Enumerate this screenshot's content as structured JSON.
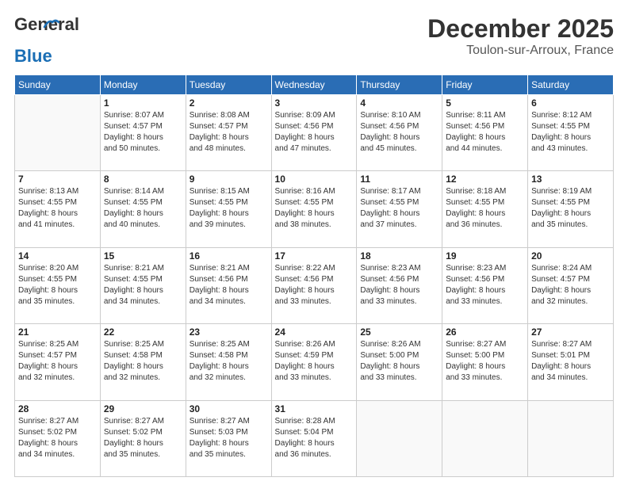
{
  "header": {
    "logo_general": "General",
    "logo_blue": "Blue",
    "month_title": "December 2025",
    "location": "Toulon-sur-Arroux, France"
  },
  "days_of_week": [
    "Sunday",
    "Monday",
    "Tuesday",
    "Wednesday",
    "Thursday",
    "Friday",
    "Saturday"
  ],
  "weeks": [
    [
      {
        "day": null,
        "info": null
      },
      {
        "day": "1",
        "info": "Sunrise: 8:07 AM\nSunset: 4:57 PM\nDaylight: 8 hours\nand 50 minutes."
      },
      {
        "day": "2",
        "info": "Sunrise: 8:08 AM\nSunset: 4:57 PM\nDaylight: 8 hours\nand 48 minutes."
      },
      {
        "day": "3",
        "info": "Sunrise: 8:09 AM\nSunset: 4:56 PM\nDaylight: 8 hours\nand 47 minutes."
      },
      {
        "day": "4",
        "info": "Sunrise: 8:10 AM\nSunset: 4:56 PM\nDaylight: 8 hours\nand 45 minutes."
      },
      {
        "day": "5",
        "info": "Sunrise: 8:11 AM\nSunset: 4:56 PM\nDaylight: 8 hours\nand 44 minutes."
      },
      {
        "day": "6",
        "info": "Sunrise: 8:12 AM\nSunset: 4:55 PM\nDaylight: 8 hours\nand 43 minutes."
      }
    ],
    [
      {
        "day": "7",
        "info": "Sunrise: 8:13 AM\nSunset: 4:55 PM\nDaylight: 8 hours\nand 41 minutes."
      },
      {
        "day": "8",
        "info": "Sunrise: 8:14 AM\nSunset: 4:55 PM\nDaylight: 8 hours\nand 40 minutes."
      },
      {
        "day": "9",
        "info": "Sunrise: 8:15 AM\nSunset: 4:55 PM\nDaylight: 8 hours\nand 39 minutes."
      },
      {
        "day": "10",
        "info": "Sunrise: 8:16 AM\nSunset: 4:55 PM\nDaylight: 8 hours\nand 38 minutes."
      },
      {
        "day": "11",
        "info": "Sunrise: 8:17 AM\nSunset: 4:55 PM\nDaylight: 8 hours\nand 37 minutes."
      },
      {
        "day": "12",
        "info": "Sunrise: 8:18 AM\nSunset: 4:55 PM\nDaylight: 8 hours\nand 36 minutes."
      },
      {
        "day": "13",
        "info": "Sunrise: 8:19 AM\nSunset: 4:55 PM\nDaylight: 8 hours\nand 35 minutes."
      }
    ],
    [
      {
        "day": "14",
        "info": "Sunrise: 8:20 AM\nSunset: 4:55 PM\nDaylight: 8 hours\nand 35 minutes."
      },
      {
        "day": "15",
        "info": "Sunrise: 8:21 AM\nSunset: 4:55 PM\nDaylight: 8 hours\nand 34 minutes."
      },
      {
        "day": "16",
        "info": "Sunrise: 8:21 AM\nSunset: 4:56 PM\nDaylight: 8 hours\nand 34 minutes."
      },
      {
        "day": "17",
        "info": "Sunrise: 8:22 AM\nSunset: 4:56 PM\nDaylight: 8 hours\nand 33 minutes."
      },
      {
        "day": "18",
        "info": "Sunrise: 8:23 AM\nSunset: 4:56 PM\nDaylight: 8 hours\nand 33 minutes."
      },
      {
        "day": "19",
        "info": "Sunrise: 8:23 AM\nSunset: 4:56 PM\nDaylight: 8 hours\nand 33 minutes."
      },
      {
        "day": "20",
        "info": "Sunrise: 8:24 AM\nSunset: 4:57 PM\nDaylight: 8 hours\nand 32 minutes."
      }
    ],
    [
      {
        "day": "21",
        "info": "Sunrise: 8:25 AM\nSunset: 4:57 PM\nDaylight: 8 hours\nand 32 minutes."
      },
      {
        "day": "22",
        "info": "Sunrise: 8:25 AM\nSunset: 4:58 PM\nDaylight: 8 hours\nand 32 minutes."
      },
      {
        "day": "23",
        "info": "Sunrise: 8:25 AM\nSunset: 4:58 PM\nDaylight: 8 hours\nand 32 minutes."
      },
      {
        "day": "24",
        "info": "Sunrise: 8:26 AM\nSunset: 4:59 PM\nDaylight: 8 hours\nand 33 minutes."
      },
      {
        "day": "25",
        "info": "Sunrise: 8:26 AM\nSunset: 5:00 PM\nDaylight: 8 hours\nand 33 minutes."
      },
      {
        "day": "26",
        "info": "Sunrise: 8:27 AM\nSunset: 5:00 PM\nDaylight: 8 hours\nand 33 minutes."
      },
      {
        "day": "27",
        "info": "Sunrise: 8:27 AM\nSunset: 5:01 PM\nDaylight: 8 hours\nand 34 minutes."
      }
    ],
    [
      {
        "day": "28",
        "info": "Sunrise: 8:27 AM\nSunset: 5:02 PM\nDaylight: 8 hours\nand 34 minutes."
      },
      {
        "day": "29",
        "info": "Sunrise: 8:27 AM\nSunset: 5:02 PM\nDaylight: 8 hours\nand 35 minutes."
      },
      {
        "day": "30",
        "info": "Sunrise: 8:27 AM\nSunset: 5:03 PM\nDaylight: 8 hours\nand 35 minutes."
      },
      {
        "day": "31",
        "info": "Sunrise: 8:28 AM\nSunset: 5:04 PM\nDaylight: 8 hours\nand 36 minutes."
      },
      {
        "day": null,
        "info": null
      },
      {
        "day": null,
        "info": null
      },
      {
        "day": null,
        "info": null
      }
    ]
  ]
}
